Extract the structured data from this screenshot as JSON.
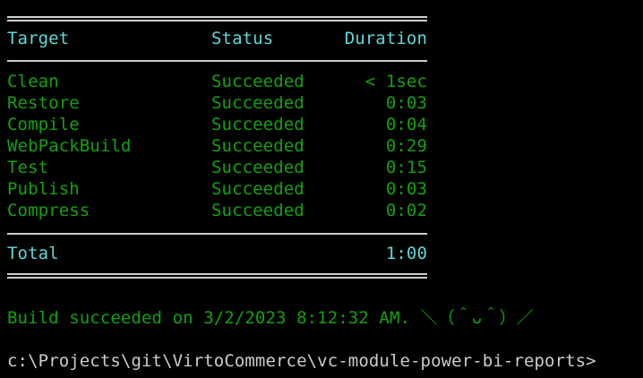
{
  "colors": {
    "background": "#000000",
    "cyan": "#61d6d6",
    "green": "#13a10e",
    "gray": "#cccccc"
  },
  "table": {
    "headers": {
      "target": "Target",
      "status": "Status",
      "duration": "Duration"
    },
    "rows": [
      {
        "target": "Clean",
        "status": "Succeeded",
        "duration": "< 1sec"
      },
      {
        "target": "Restore",
        "status": "Succeeded",
        "duration": "0:03"
      },
      {
        "target": "Compile",
        "status": "Succeeded",
        "duration": "0:04"
      },
      {
        "target": "WebPackBuild",
        "status": "Succeeded",
        "duration": "0:29"
      },
      {
        "target": "Test",
        "status": "Succeeded",
        "duration": "0:15"
      },
      {
        "target": "Publish",
        "status": "Succeeded",
        "duration": "0:03"
      },
      {
        "target": "Compress",
        "status": "Succeeded",
        "duration": "0:02"
      }
    ],
    "total": {
      "label": "Total",
      "duration": "1:00"
    }
  },
  "build_message": "Build succeeded on 3/2/2023 8:12:32 AM. ＼（＾ᴗ＾）／",
  "prompt": "c:\\Projects\\git\\VirtoCommerce\\vc-module-power-bi-reports>"
}
